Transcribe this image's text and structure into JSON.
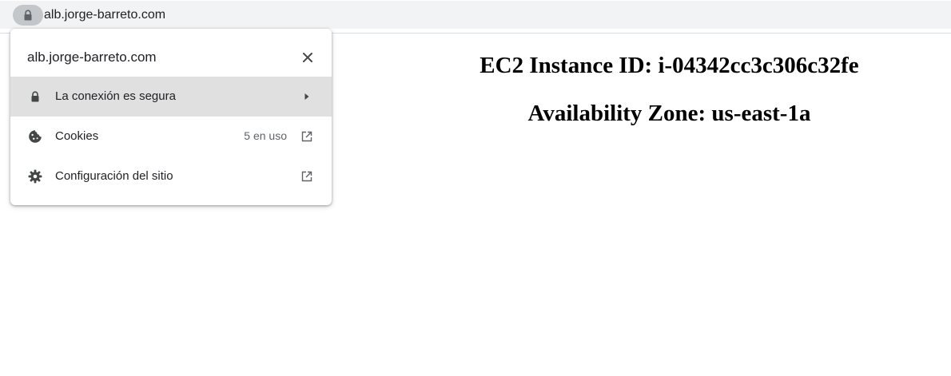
{
  "browser": {
    "url": "alb.jorge-barreto.com",
    "lock_icon": "lock-icon"
  },
  "page": {
    "instance_heading": "EC2 Instance ID: i-04342cc3c306c32fe",
    "zone_heading": "Availability Zone: us-east-1a"
  },
  "site_info_popup": {
    "title": "alb.jorge-barreto.com",
    "close_icon": "close-icon",
    "items": [
      {
        "label": "La conexión es segura",
        "meta": "",
        "icon": "lock-icon",
        "trail_icon": "arrow-right-icon"
      },
      {
        "label": "Cookies",
        "meta": "5 en uso",
        "icon": "cookie-icon",
        "trail_icon": "open-in-new-icon"
      },
      {
        "label": "Configuración del sitio",
        "meta": "",
        "icon": "gear-icon",
        "trail_icon": "open-in-new-icon"
      }
    ]
  },
  "colors": {
    "omnibox_bg": "#f1f3f4",
    "lock_chip_bg": "#c4c7ca",
    "selected_row_bg": "#e0e0e0",
    "icon_gray": "#5f6368"
  }
}
